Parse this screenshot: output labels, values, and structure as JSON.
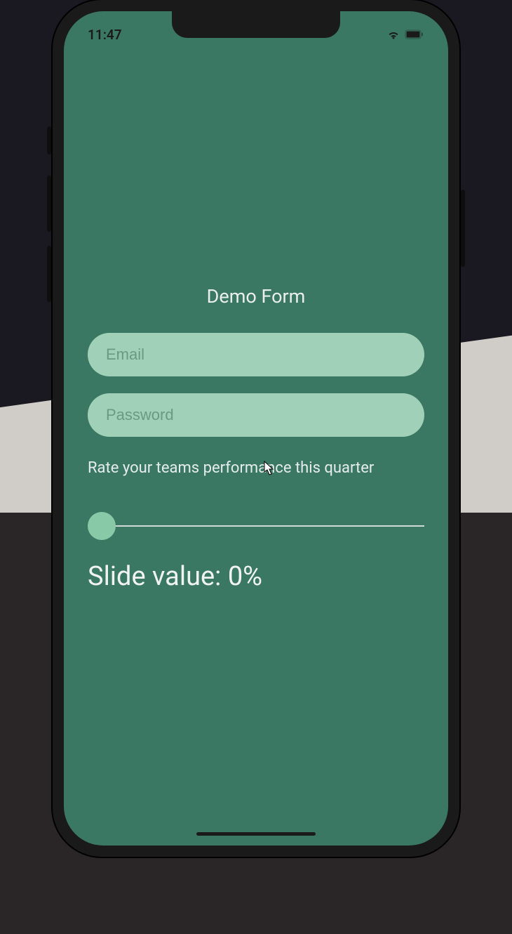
{
  "status": {
    "time": "11:47"
  },
  "form": {
    "title": "Demo Form",
    "email_placeholder": "Email",
    "email_value": "",
    "password_placeholder": "Password",
    "password_value": "",
    "rate_label": "Rate your teams performance this quarter",
    "slider_value": 0,
    "slide_value_text": "Slide value: 0%"
  },
  "colors": {
    "screen_bg": "#3a7864",
    "input_bg": "#a1d0b8",
    "thumb": "#88c9a7"
  }
}
